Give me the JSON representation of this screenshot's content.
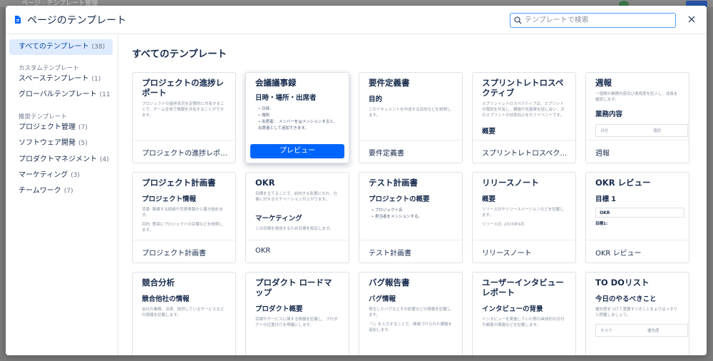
{
  "backdrop": {
    "title": "ページ · テンプレート管理"
  },
  "header": {
    "title": "ページのテンプレート",
    "search_placeholder": "テンプレートで検索"
  },
  "sidebar": {
    "all": {
      "label": "すべてのテンプレート",
      "count": "(38)"
    },
    "custom_section": "カスタムテンプレート",
    "custom": [
      {
        "label": "スペーステンプレート",
        "count": "(1)"
      },
      {
        "label": "グローバルテンプレート",
        "count": "(11"
      }
    ],
    "recommended_section": "推奨テンプレート",
    "recommended": [
      {
        "label": "プロジェクト管理",
        "count": "(7)"
      },
      {
        "label": "ソフトウェア開発",
        "count": "(5)"
      },
      {
        "label": "プロダクトマネジメント",
        "count": "(4)"
      },
      {
        "label": "マーケティング",
        "count": "(3)"
      },
      {
        "label": "チームワーク",
        "count": "(7)"
      }
    ]
  },
  "main": {
    "title": "すべてのテンプレート",
    "preview_button": "プレビュー",
    "cards": [
      {
        "heading": "プロジェクトの進捗レポート",
        "text": "プロジェクトの進捗状況を定期的に共有することで、チーム全体で情報を共有することができます。",
        "label": "プロジェクトの進捗レポー..."
      },
      {
        "heading": "会議議事録",
        "sub": "日時・場所・出席者",
        "bullets": [
          "日時:",
          "場所:",
          "出席者： メンバーを@メンションすると、出席者として追加できます。"
        ],
        "label": ""
      },
      {
        "heading": "要件定義書",
        "sub": "目的",
        "text": "このドキュメントを作成する目的などを説明します。",
        "label": "要件定義書"
      },
      {
        "heading": "スプリントレトロスペクティブ",
        "text": "スプリントレトロスペクティブは、スプリントの階段を共有し、課題や改善案を話し合い、次のスプリントの効率向上を行うイベントです。",
        "sub": "概要",
        "label": "スプリントレトロスペクテ..."
      },
      {
        "heading": "週報",
        "text": "一週間の業務内容及び達成度を記入し、成長を確認します。",
        "sub": "業務内容",
        "table": [
          "日付",
          "項目"
        ],
        "label": "週報"
      },
      {
        "heading": "プロジェクト計画書",
        "sub": "プロジェクト情報",
        "text": "背景: 関連する経緯や背景情報から書き始めます。",
        "text2": "目的: 簡潔にプロジェクトの目標などを説明します。",
        "label": "プロジェクト計画書"
      },
      {
        "heading": "OKR",
        "text": "目標を立てることで、前向きな影響になれ、仕事に対するモチベーションが上がります。",
        "sub": "マーケティング",
        "text2": "この目標を達成するため目標を設定します。",
        "label": "OKR"
      },
      {
        "heading": "テスト計画書",
        "sub": "プロジェクトの概要",
        "bullets": [
          "プロジェクト名",
          "担当者をメンションする。"
        ],
        "label": "テスト計画書"
      },
      {
        "heading": "リリースノート",
        "sub": "概要",
        "text": "リリース日やリリースバージョンなどを記載します。",
        "text2": "リリース日: 2023年9月",
        "label": "リリースノート"
      },
      {
        "heading": "OKR レビュー",
        "sub": "目標 1",
        "box": "OKR",
        "text2": "目標1:",
        "label": "OKR レビュー"
      },
      {
        "heading": "競合分析",
        "sub": "競合他社の情報",
        "text": "会社の業務、沿革、提供しているサービスなどの情報を記載します。",
        "label": ""
      },
      {
        "heading": "プロダクト ロードマップ",
        "sub": "プロダクト概要",
        "text": "目標やサービスに関する情報を記載し、プロダクトの位置付けを明確にします。",
        "label": ""
      },
      {
        "heading": "バグ報告書",
        "sub": "バグ情報",
        "text": "発生したバグなどその影響などの情報を記載します。",
        "text2": "「/」を入力することで、関連づけられた課題を追加します。",
        "label": ""
      },
      {
        "heading": "ユーザーインタビューレポート",
        "sub": "インタビューの背景",
        "text": "インタビューを実施していた際の具体的な日付や顧客の情報などを記載します。",
        "label": ""
      },
      {
        "heading": "TO DOリスト",
        "sub": "今日のやるべきこと",
        "text": "優先度をつけて重要すべきことをよりはっきりと把握しましょう。",
        "table": [
          "タスク",
          "優先度"
        ],
        "label": ""
      }
    ]
  },
  "colors": {
    "accent": "#0065ff",
    "active_bg": "#deebff",
    "border": "#dfe1e6"
  }
}
